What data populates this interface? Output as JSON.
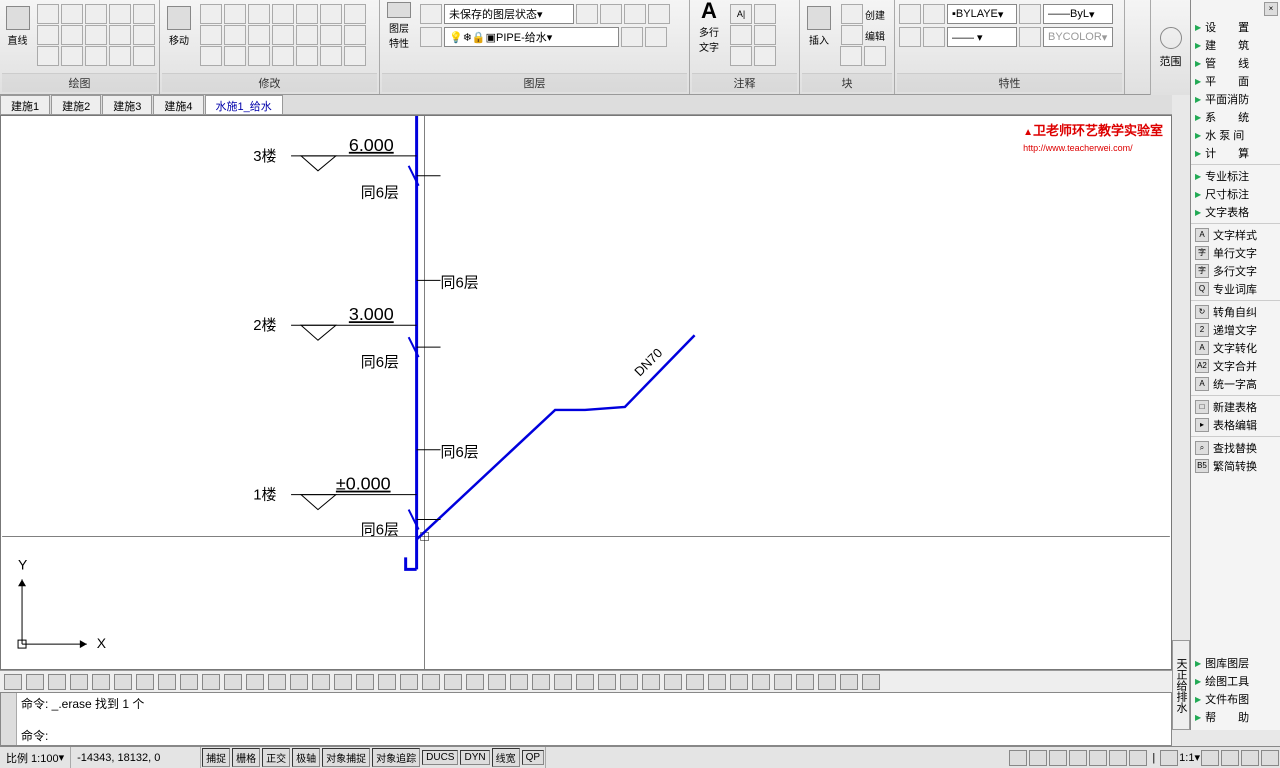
{
  "ribbon": {
    "panels": {
      "draw": {
        "title": "绘图",
        "line_label": "直线"
      },
      "modify": {
        "title": "修改",
        "move_label": "移动"
      },
      "layers": {
        "title": "图层",
        "props_label": "图层\n特性",
        "state_combo": "未保存的图层状态",
        "layer_combo": "PIPE-给水"
      },
      "annotate": {
        "title": "注释",
        "mtext_label": "多行\n文字",
        "a_icon": "A",
        "ai_icon": "A|"
      },
      "block": {
        "title": "块",
        "insert_label": "插入",
        "create_label": "创建",
        "edit_label": "编辑"
      },
      "props": {
        "title": "特性",
        "color_combo": "BYLAYE",
        "ltype_combo": "ByL",
        "bycolor": "BYCOLOR"
      }
    },
    "scope_label": "范围"
  },
  "doc_tabs": [
    "建施1",
    "建施2",
    "建施3",
    "建施4",
    "水施1_给水"
  ],
  "active_tab_index": 4,
  "drawing": {
    "floors": [
      {
        "label": "3楼",
        "elev": "6.000",
        "note": "同6层"
      },
      {
        "label": "2楼",
        "elev": "3.000",
        "note": "同6层"
      },
      {
        "label": "1楼",
        "elev": "±0.000",
        "note": "同6层"
      }
    ],
    "mid_note": "同6层",
    "pipe_label": "DN70",
    "ucs": {
      "x": "X",
      "y": "Y"
    }
  },
  "watermark": {
    "title": "卫老师环艺教学实验室",
    "url": "http://www.teacherwei.com/"
  },
  "side": {
    "groups1": [
      "设　　置",
      "建　　筑",
      "管　　线",
      "平　　面",
      "平面消防",
      "系　　统",
      "水 泵 间",
      "计　　算"
    ],
    "groups2": [
      "专业标注",
      "尺寸标注",
      "文字表格"
    ],
    "text_tools": [
      {
        "icon": "A",
        "label": "文字样式"
      },
      {
        "icon": "字",
        "label": "单行文字"
      },
      {
        "icon": "字",
        "label": "多行文字"
      },
      {
        "icon": "Q",
        "label": "专业词库"
      }
    ],
    "edit_tools": [
      {
        "icon": "↻",
        "label": "转角自纠"
      },
      {
        "icon": "2",
        "label": "递增文字"
      },
      {
        "icon": "A",
        "label": "文字转化"
      },
      {
        "icon": "A2",
        "label": "文字合并"
      },
      {
        "icon": "A",
        "label": "统一字高"
      }
    ],
    "table_tools": [
      {
        "icon": "□",
        "label": "新建表格"
      },
      {
        "icon": "▸",
        "label": "表格编辑"
      }
    ],
    "replace_tools": [
      {
        "icon": "⌕",
        "label": "查找替换"
      },
      {
        "icon": "B5",
        "label": "繁简转换"
      }
    ],
    "bottom": [
      "图库图层",
      "绘图工具",
      "文件布图",
      "帮　　助"
    ],
    "vertical_title": "天正给排水"
  },
  "cmd": {
    "line1": "命令: _.erase 找到 1 个",
    "line2": "命令:"
  },
  "status": {
    "scale": "比例 1:100",
    "coords": "-14343, 18132, 0",
    "toggles": [
      "捕捉",
      "栅格",
      "正交",
      "极轴",
      "对象捕捉",
      "对象追踪",
      "DUCS",
      "DYN",
      "线宽",
      "QP"
    ],
    "right_label": "1:1"
  }
}
